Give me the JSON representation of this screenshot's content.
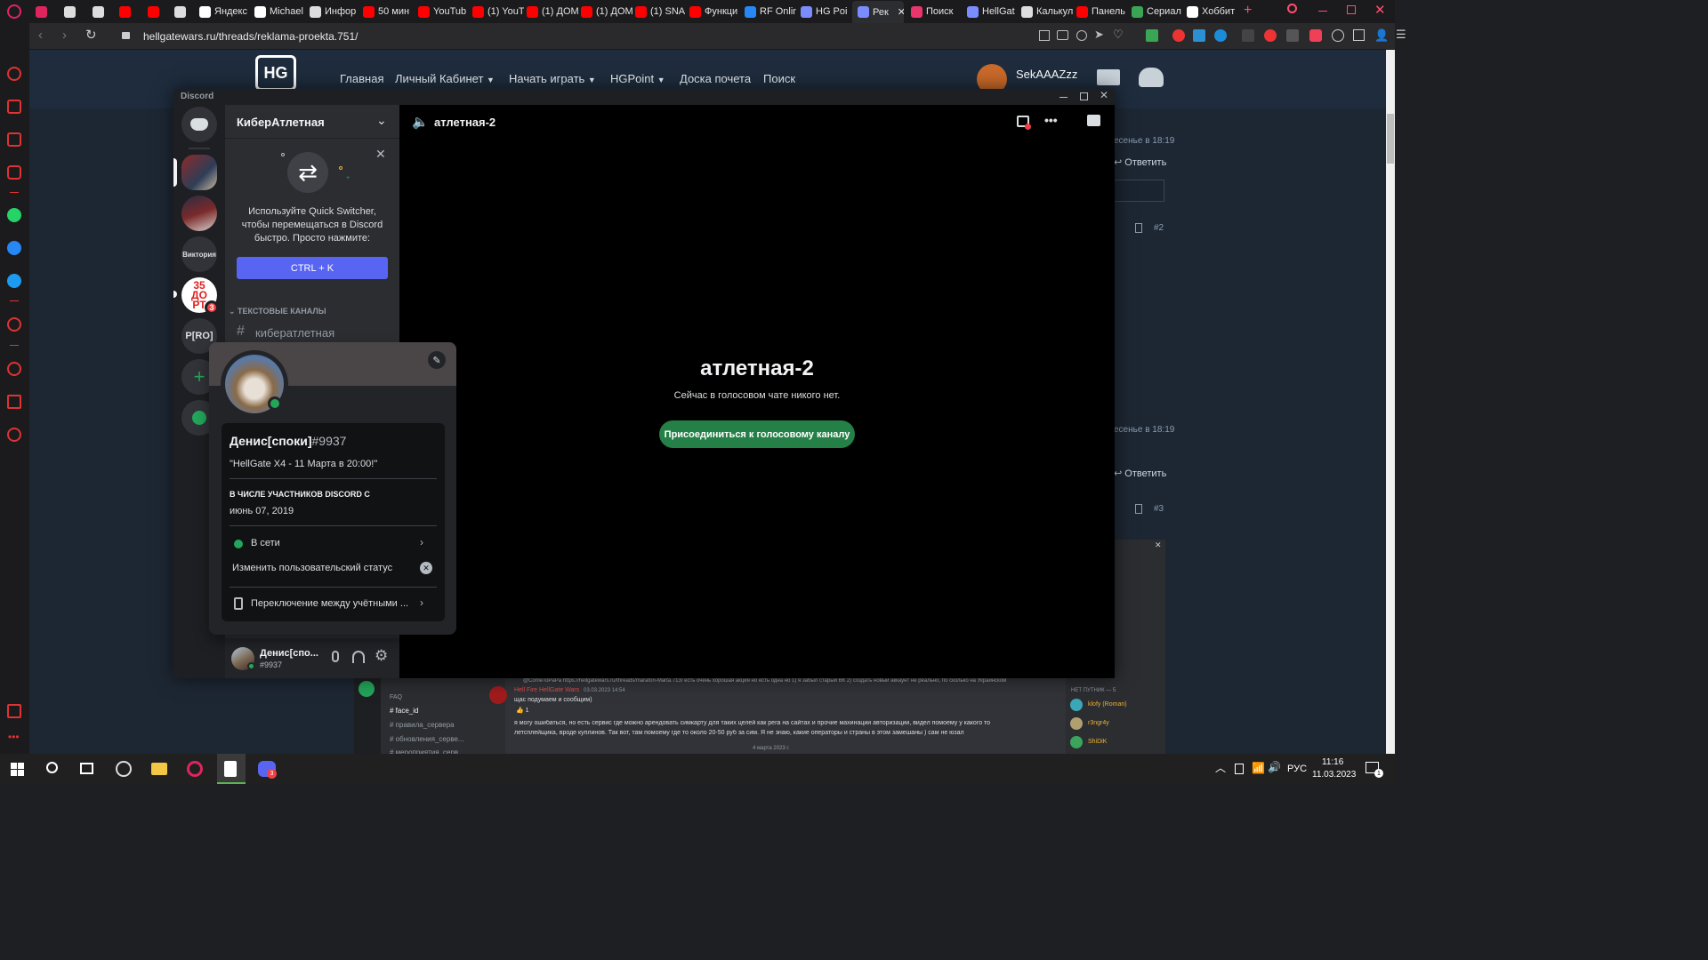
{
  "browser": {
    "tabs": [
      {
        "label": "",
        "color": "#e0245e"
      },
      {
        "label": "",
        "color": "#dddddd"
      },
      {
        "label": "",
        "color": "#dddddd"
      },
      {
        "label": "",
        "color": "#ff0000"
      },
      {
        "label": "",
        "color": "#ff0000"
      },
      {
        "label": "",
        "color": "#dddddd"
      },
      {
        "label": "Яндекс",
        "color": "#ffffff"
      },
      {
        "label": "Michael",
        "color": "#ffffff"
      },
      {
        "label": "Инфор",
        "color": "#dddddd"
      },
      {
        "label": "50 мин",
        "color": "#ff0000"
      },
      {
        "label": "YouTub",
        "color": "#ff0000"
      },
      {
        "label": "(1) YouT",
        "color": "#ff0000"
      },
      {
        "label": "(1) ДОМ",
        "color": "#ff0000"
      },
      {
        "label": "(1) ДОМ",
        "color": "#ff0000"
      },
      {
        "label": "(1) SNA",
        "color": "#ff0000"
      },
      {
        "label": "Функци",
        "color": "#ff0000"
      },
      {
        "label": "RF Onlin",
        "color": "#2787f5"
      },
      {
        "label": "HG Poi",
        "color": "#7b8cff"
      },
      {
        "label": "Рек",
        "color": "#7b8cff"
      },
      {
        "label": "Поиск",
        "color": "#e8356b"
      },
      {
        "label": "HellGat",
        "color": "#7b8cff"
      },
      {
        "label": "Калькул",
        "color": "#dddddd"
      },
      {
        "label": "Панель",
        "color": "#ff0000"
      },
      {
        "label": "Сериал",
        "color": "#3aa655"
      },
      {
        "label": "Хоббит",
        "color": "#ffffff"
      }
    ],
    "url": "hellgatewars.ru/threads/reklama-proekta.751/"
  },
  "site": {
    "logo": "HG",
    "nav": [
      "Главная",
      "Личный Кабинет",
      "Начать играть",
      "HGPoint",
      "Доска почета",
      "Поиск"
    ],
    "username": "SekAAAZzz",
    "right_snippets": {
      "time1": "есенье в 18:19",
      "reply1": "Ответить",
      "post2": "#2",
      "time2": "есенье в 18:19",
      "reply2": "Ответить",
      "post3": "#3"
    }
  },
  "discord": {
    "app_title": "Discord",
    "guilds": {
      "victory_label": "Виктория",
      "countdown_label": "35 ДО РТ",
      "countdown_badge": "3",
      "pro_label": "P[RO]"
    },
    "server_name": "КиберАтлетная",
    "quick_switcher": {
      "text": "Используйте Quick Switcher, чтобы перемещаться в Discord быстро. Просто нажмите:",
      "button": "CTRL + K"
    },
    "category": "ТЕКСТОВЫЕ КАНАЛЫ",
    "channel": "кибератлетная",
    "voice_channel_header": "атлетная-2",
    "empty_title": "атлетная-2",
    "empty_subtitle": "Сейчас в голосовом чате никого нет.",
    "join_button": "Присоединиться к голосовому каналу",
    "user_panel": {
      "name": "Денис[спо...",
      "tag": "#9937"
    },
    "profile": {
      "display_name": "Денис[споки]",
      "discriminator": "#9937",
      "custom_status": "\"HellGate X4 - 11 Марта в 20:00!\"",
      "member_since_label": "В ЧИСЛЕ УЧАСТНИКОВ DISCORD С",
      "member_since": "июнь 07, 2019",
      "status": "В сети",
      "edit_status": "Изменить пользовательский статус",
      "switch_accounts": "Переключение между учётными ..."
    }
  },
  "background_discord": {
    "channels": [
      "FAQ",
      "face_id",
      "правила_сервера",
      "обновления_серве...",
      "мероприятия_серв..."
    ],
    "message_author": "Hell Fire HellGate Wars",
    "message_time": "03.03.2023 14:54",
    "msg_line1": "@ComeToPaPa https://hellgatewars.ru/threads/marafon-Marta.713/ есть очень хорошая акция но есть одна но 1) я забыл старый ВК 2) создать новый аккаунт не реально, по сколько на Украинском",
    "msg_line2": "щас подумаем и сообщим)",
    "msg_line3": "я могу ошибаться, но есть сервис где можно арендовать симкарту для таких целей как рега на сайтах и прочие махинации авторизации, видел помоему у какого то",
    "msg_line4": "летсплейщика, вроде куплинов. Так вот, там помоему где то около 20-50 руб за сим. Я не знаю, какие операторы и страны в этом замешаны ) сам не юзал",
    "date_divider": "4 марта 2023 г.",
    "members_header": "НЕТ ПУТНИК — 5",
    "members": [
      "klofy (Roman)",
      "r3ngr4y",
      "ShiDiK"
    ]
  },
  "taskbar": {
    "lang": "РУС",
    "time": "11:16",
    "date": "11.03.2023",
    "notif_count": "1",
    "discord_badge": "3"
  }
}
